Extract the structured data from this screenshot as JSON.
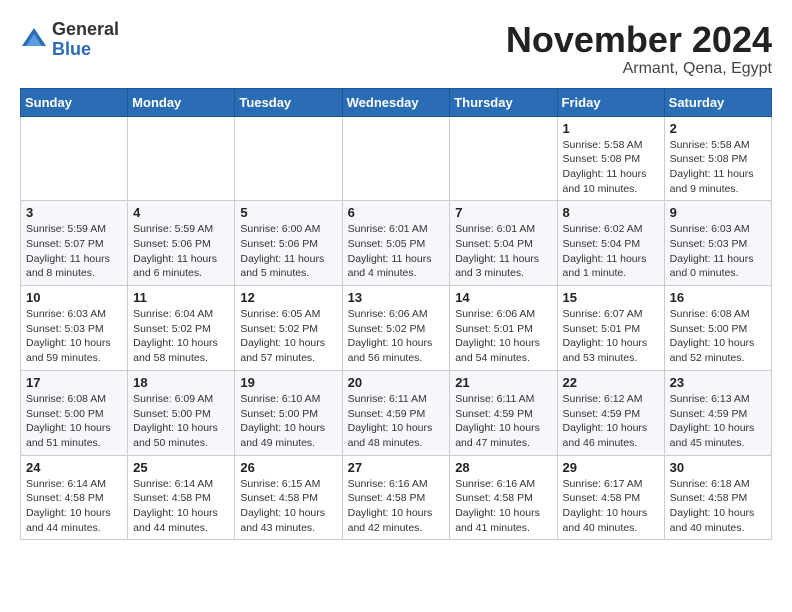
{
  "header": {
    "logo_general": "General",
    "logo_blue": "Blue",
    "month_title": "November 2024",
    "location": "Armant, Qena, Egypt"
  },
  "weekdays": [
    "Sunday",
    "Monday",
    "Tuesday",
    "Wednesday",
    "Thursday",
    "Friday",
    "Saturday"
  ],
  "weeks": [
    [
      {
        "day": "",
        "info": ""
      },
      {
        "day": "",
        "info": ""
      },
      {
        "day": "",
        "info": ""
      },
      {
        "day": "",
        "info": ""
      },
      {
        "day": "",
        "info": ""
      },
      {
        "day": "1",
        "info": "Sunrise: 5:58 AM\nSunset: 5:08 PM\nDaylight: 11 hours and 10 minutes."
      },
      {
        "day": "2",
        "info": "Sunrise: 5:58 AM\nSunset: 5:08 PM\nDaylight: 11 hours and 9 minutes."
      }
    ],
    [
      {
        "day": "3",
        "info": "Sunrise: 5:59 AM\nSunset: 5:07 PM\nDaylight: 11 hours and 8 minutes."
      },
      {
        "day": "4",
        "info": "Sunrise: 5:59 AM\nSunset: 5:06 PM\nDaylight: 11 hours and 6 minutes."
      },
      {
        "day": "5",
        "info": "Sunrise: 6:00 AM\nSunset: 5:06 PM\nDaylight: 11 hours and 5 minutes."
      },
      {
        "day": "6",
        "info": "Sunrise: 6:01 AM\nSunset: 5:05 PM\nDaylight: 11 hours and 4 minutes."
      },
      {
        "day": "7",
        "info": "Sunrise: 6:01 AM\nSunset: 5:04 PM\nDaylight: 11 hours and 3 minutes."
      },
      {
        "day": "8",
        "info": "Sunrise: 6:02 AM\nSunset: 5:04 PM\nDaylight: 11 hours and 1 minute."
      },
      {
        "day": "9",
        "info": "Sunrise: 6:03 AM\nSunset: 5:03 PM\nDaylight: 11 hours and 0 minutes."
      }
    ],
    [
      {
        "day": "10",
        "info": "Sunrise: 6:03 AM\nSunset: 5:03 PM\nDaylight: 10 hours and 59 minutes."
      },
      {
        "day": "11",
        "info": "Sunrise: 6:04 AM\nSunset: 5:02 PM\nDaylight: 10 hours and 58 minutes."
      },
      {
        "day": "12",
        "info": "Sunrise: 6:05 AM\nSunset: 5:02 PM\nDaylight: 10 hours and 57 minutes."
      },
      {
        "day": "13",
        "info": "Sunrise: 6:06 AM\nSunset: 5:02 PM\nDaylight: 10 hours and 56 minutes."
      },
      {
        "day": "14",
        "info": "Sunrise: 6:06 AM\nSunset: 5:01 PM\nDaylight: 10 hours and 54 minutes."
      },
      {
        "day": "15",
        "info": "Sunrise: 6:07 AM\nSunset: 5:01 PM\nDaylight: 10 hours and 53 minutes."
      },
      {
        "day": "16",
        "info": "Sunrise: 6:08 AM\nSunset: 5:00 PM\nDaylight: 10 hours and 52 minutes."
      }
    ],
    [
      {
        "day": "17",
        "info": "Sunrise: 6:08 AM\nSunset: 5:00 PM\nDaylight: 10 hours and 51 minutes."
      },
      {
        "day": "18",
        "info": "Sunrise: 6:09 AM\nSunset: 5:00 PM\nDaylight: 10 hours and 50 minutes."
      },
      {
        "day": "19",
        "info": "Sunrise: 6:10 AM\nSunset: 5:00 PM\nDaylight: 10 hours and 49 minutes."
      },
      {
        "day": "20",
        "info": "Sunrise: 6:11 AM\nSunset: 4:59 PM\nDaylight: 10 hours and 48 minutes."
      },
      {
        "day": "21",
        "info": "Sunrise: 6:11 AM\nSunset: 4:59 PM\nDaylight: 10 hours and 47 minutes."
      },
      {
        "day": "22",
        "info": "Sunrise: 6:12 AM\nSunset: 4:59 PM\nDaylight: 10 hours and 46 minutes."
      },
      {
        "day": "23",
        "info": "Sunrise: 6:13 AM\nSunset: 4:59 PM\nDaylight: 10 hours and 45 minutes."
      }
    ],
    [
      {
        "day": "24",
        "info": "Sunrise: 6:14 AM\nSunset: 4:58 PM\nDaylight: 10 hours and 44 minutes."
      },
      {
        "day": "25",
        "info": "Sunrise: 6:14 AM\nSunset: 4:58 PM\nDaylight: 10 hours and 44 minutes."
      },
      {
        "day": "26",
        "info": "Sunrise: 6:15 AM\nSunset: 4:58 PM\nDaylight: 10 hours and 43 minutes."
      },
      {
        "day": "27",
        "info": "Sunrise: 6:16 AM\nSunset: 4:58 PM\nDaylight: 10 hours and 42 minutes."
      },
      {
        "day": "28",
        "info": "Sunrise: 6:16 AM\nSunset: 4:58 PM\nDaylight: 10 hours and 41 minutes."
      },
      {
        "day": "29",
        "info": "Sunrise: 6:17 AM\nSunset: 4:58 PM\nDaylight: 10 hours and 40 minutes."
      },
      {
        "day": "30",
        "info": "Sunrise: 6:18 AM\nSunset: 4:58 PM\nDaylight: 10 hours and 40 minutes."
      }
    ]
  ]
}
